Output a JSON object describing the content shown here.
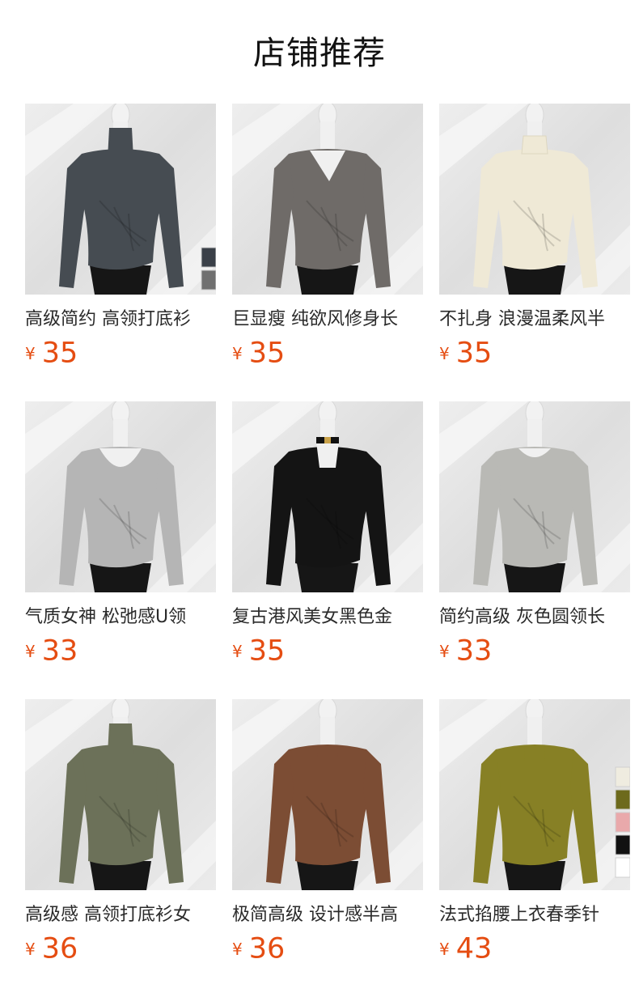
{
  "title": "店铺推荐",
  "currency": "¥",
  "price_color": "#e54d12",
  "products": [
    {
      "name": "高级简约 高领打底衫",
      "price": "35",
      "garment_color": "#464c52",
      "style": "turtleneck",
      "swatches": [
        "#3a4048",
        "#707070"
      ]
    },
    {
      "name": "巨显瘦 纯欲风修身长",
      "price": "35",
      "garment_color": "#6f6b68",
      "style": "vneck",
      "swatches": []
    },
    {
      "name": "不扎身 浪漫温柔风半",
      "price": "35",
      "garment_color": "#efe9d6",
      "style": "frill",
      "swatches": []
    },
    {
      "name": "气质女神 松弛感U领",
      "price": "33",
      "garment_color": "#b5b5b5",
      "style": "uneck",
      "swatches": []
    },
    {
      "name": "复古港风美女黑色金",
      "price": "35",
      "garment_color": "#141414",
      "style": "choker",
      "swatches": []
    },
    {
      "name": "简约高级 灰色圆领长",
      "price": "33",
      "garment_color": "#b9b9b5",
      "style": "crew",
      "swatches": []
    },
    {
      "name": "高级感 高领打底衫女",
      "price": "36",
      "garment_color": "#6c7159",
      "style": "turtleneck",
      "swatches": []
    },
    {
      "name": "极简高级 设计感半高",
      "price": "36",
      "garment_color": "#7c4d34",
      "style": "mock",
      "swatches": []
    },
    {
      "name": "法式掐腰上衣春季针",
      "price": "43",
      "garment_color": "#878025",
      "style": "mock",
      "swatches": [
        "#efece0",
        "#6d6a1c",
        "#e9a9ab",
        "#111111",
        "#ffffff"
      ]
    }
  ]
}
